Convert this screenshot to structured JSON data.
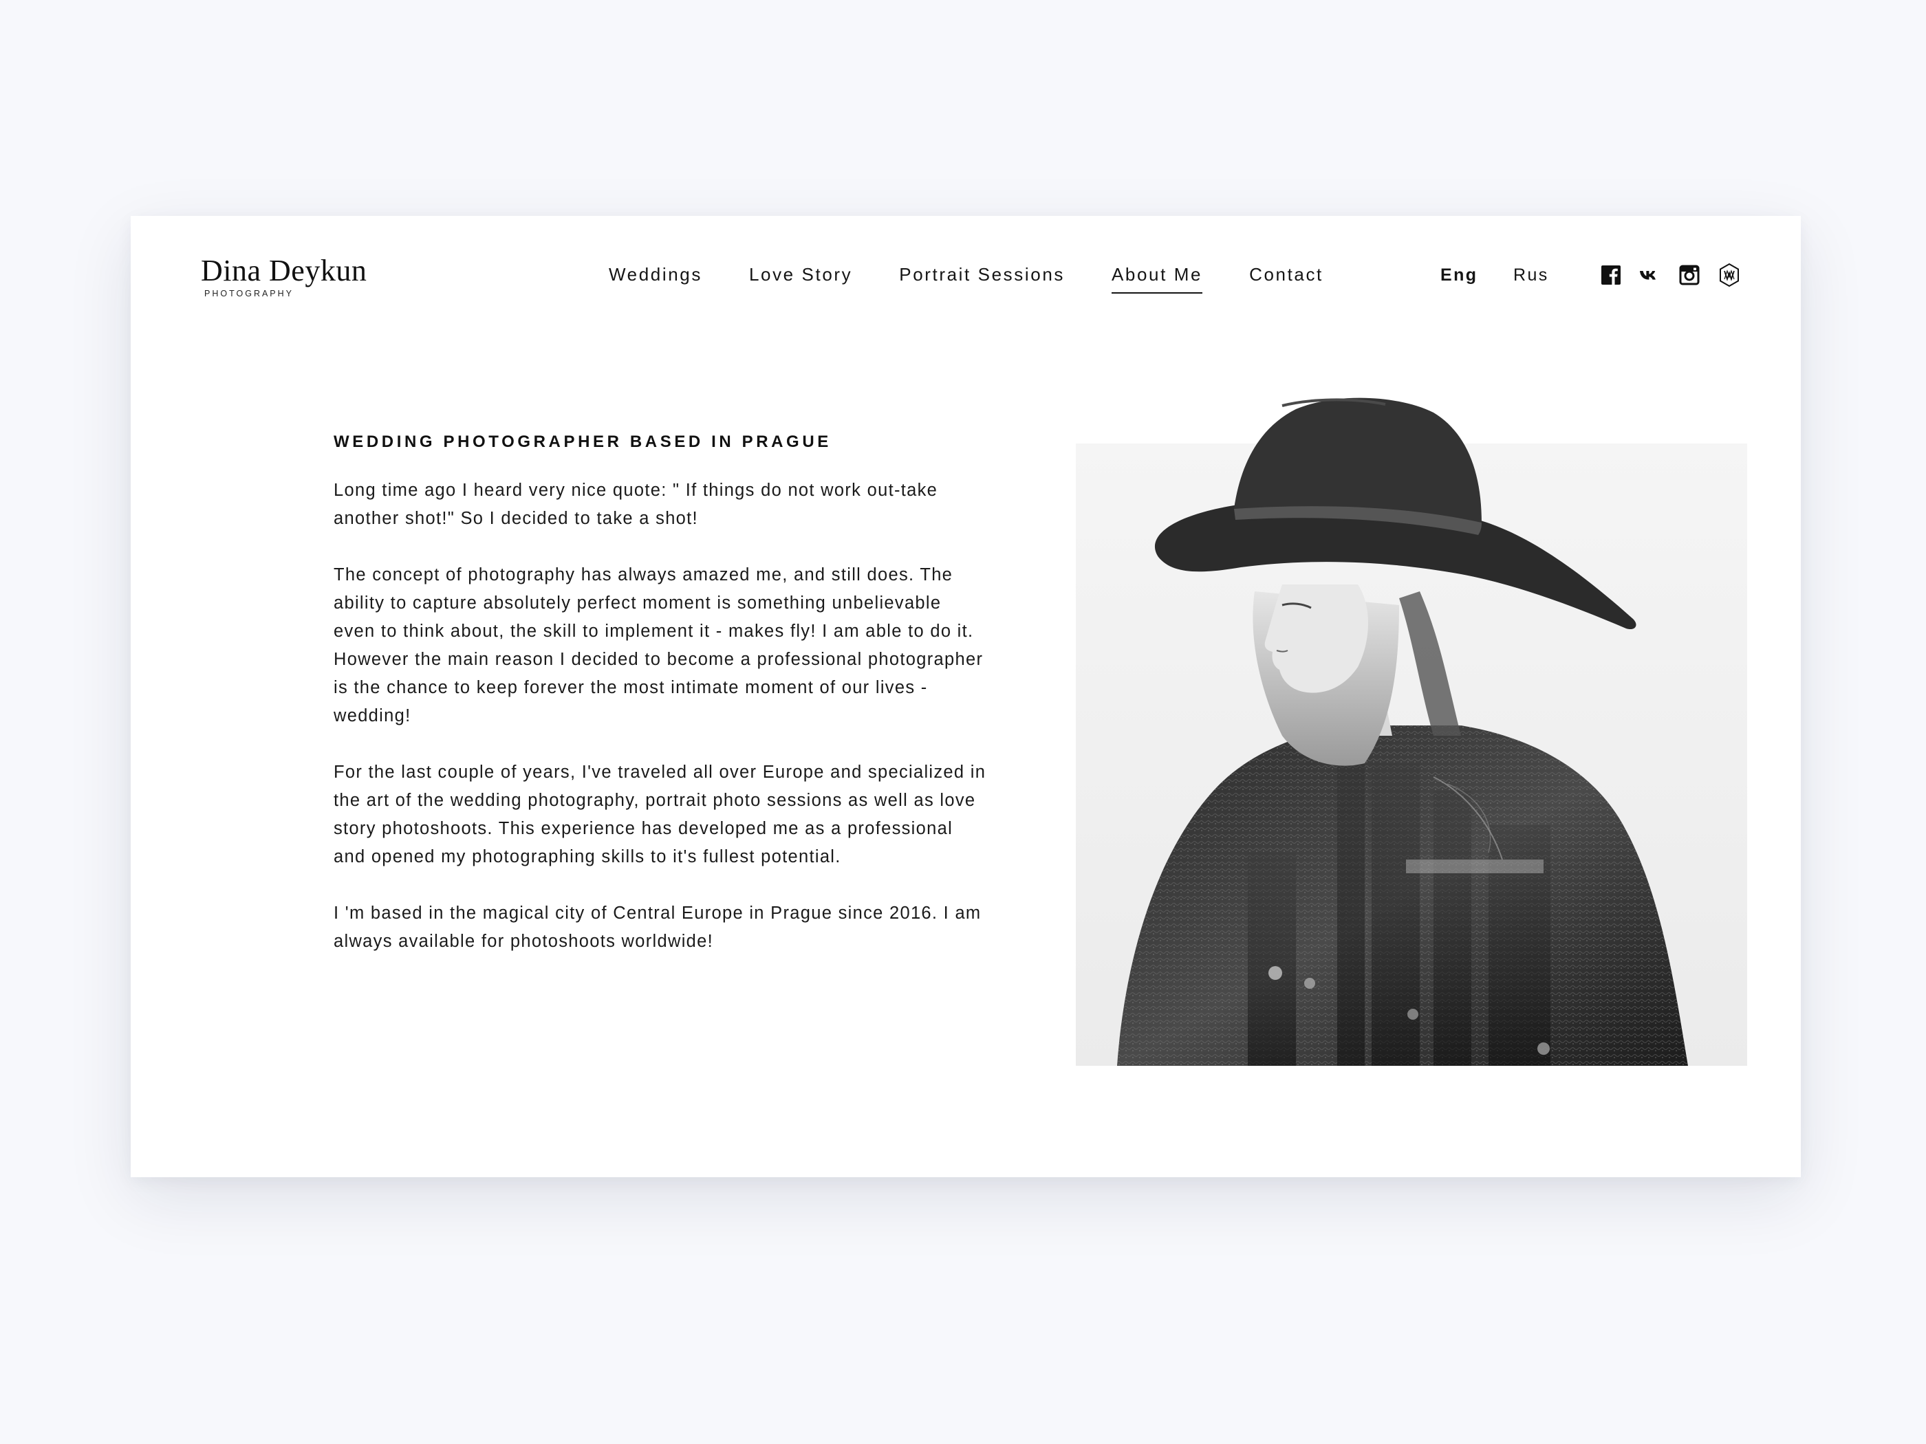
{
  "header": {
    "logo_name": "Dina Deykun",
    "logo_sub": "PHOTOGRAPHY",
    "nav": [
      {
        "label": "Weddings",
        "active": false
      },
      {
        "label": "Love Story",
        "active": false
      },
      {
        "label": "Portrait Sessions",
        "active": false
      },
      {
        "label": "About Me",
        "active": true
      },
      {
        "label": "Contact",
        "active": false
      }
    ],
    "languages": {
      "eng": "Eng",
      "rus": "Rus",
      "selected": "Eng"
    },
    "social_icons": [
      "facebook-icon",
      "vk-icon",
      "instagram-icon",
      "brand-emblem-icon"
    ]
  },
  "main": {
    "headline": "WEDDING PHOTOGRAPHER BASED IN PRAGUE",
    "paragraphs": [
      "Long time ago I heard very nice quote: \" If things do not work out-take another shot!\" So I decided to take a shot!",
      "The concept of photography has always amazed me, and still does. The ability to capture absolutely perfect moment is something unbelievable even to think about, the skill to implement it - makes fly! I am able to do it. However the main reason I decided to become a professional photographer is the chance to keep forever the most intimate moment of our lives - wedding!",
      "For the last couple of years, I've traveled all over Europe and specialized in the art of the wedding photography, portrait photo sessions as well as love story photoshoots. This experience has developed me as a professional and opened my photographing skills to it's fullest potential.",
      "I 'm based in the magical city of Central Europe in Prague since 2016. I am always available for photoshoots worldwide!"
    ],
    "photo": "portrait-photo"
  },
  "colors": {
    "page_background": "#f7f8fc",
    "card_background": "#ffffff",
    "text": "#141414",
    "photo_backdrop": "#f2f2f2"
  }
}
